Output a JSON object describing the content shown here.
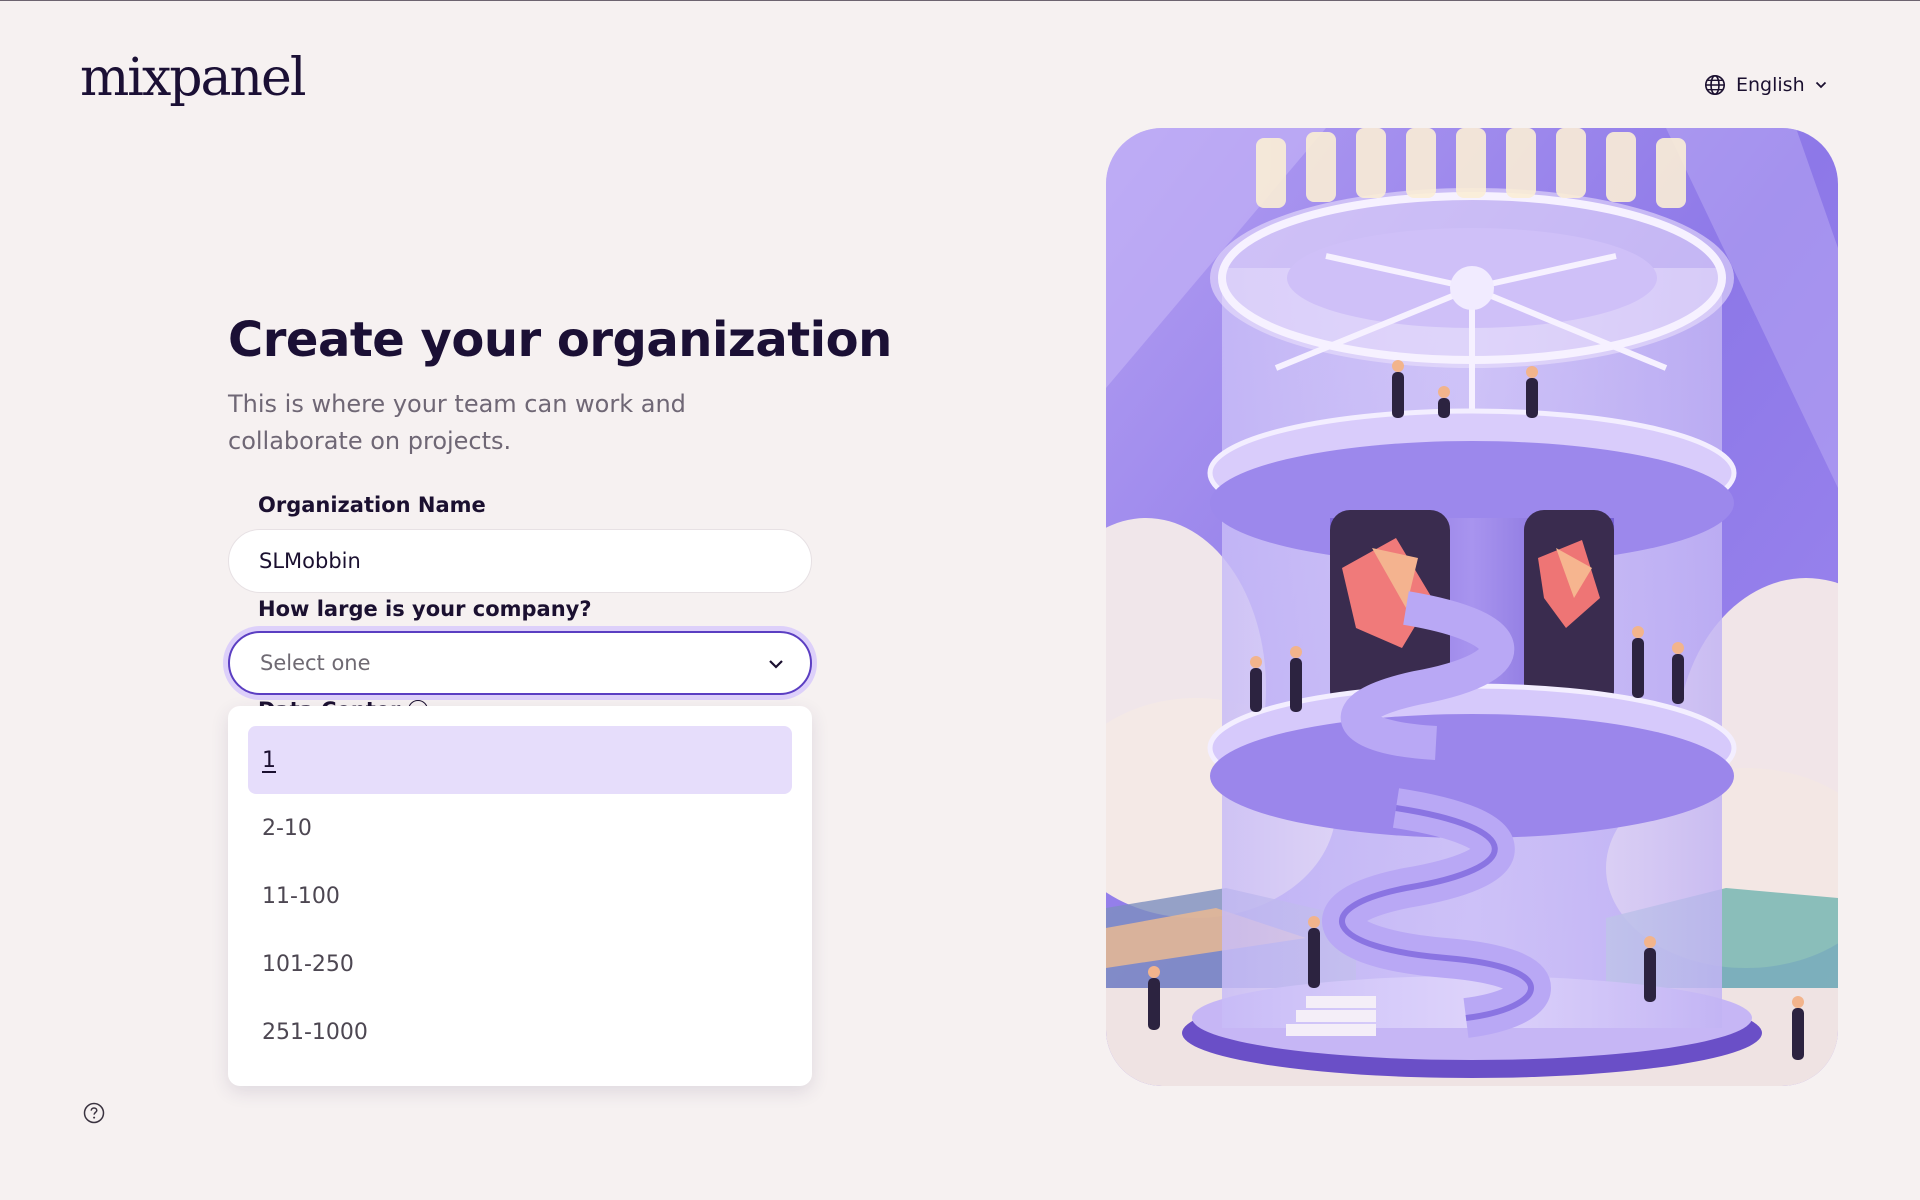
{
  "brand": {
    "logo_text": "mixpanel"
  },
  "language": {
    "label": "English"
  },
  "page": {
    "title": "Create your organization",
    "subtitle": "This is where your team can work and collaborate on projects."
  },
  "form": {
    "org_name": {
      "label": "Organization Name",
      "value": "SLMobbin"
    },
    "company_size": {
      "label": "How large is your company?",
      "placeholder": "Select one",
      "options": [
        "1",
        "2-10",
        "11-100",
        "101-250",
        "251-1000"
      ],
      "highlighted": "1"
    },
    "next_field_label": "Data Center"
  },
  "colors": {
    "accent": "#5b3ec2",
    "focus_ring": "#ddd0fa",
    "option_highlight": "#e6ddfb",
    "background": "#f6f1f1",
    "illustration_purple": "#8f7ae6"
  },
  "icons": {
    "language": "globe-icon",
    "language_caret": "chevron-down-icon",
    "select_caret": "chevron-down-icon",
    "help": "question-circle-icon"
  }
}
